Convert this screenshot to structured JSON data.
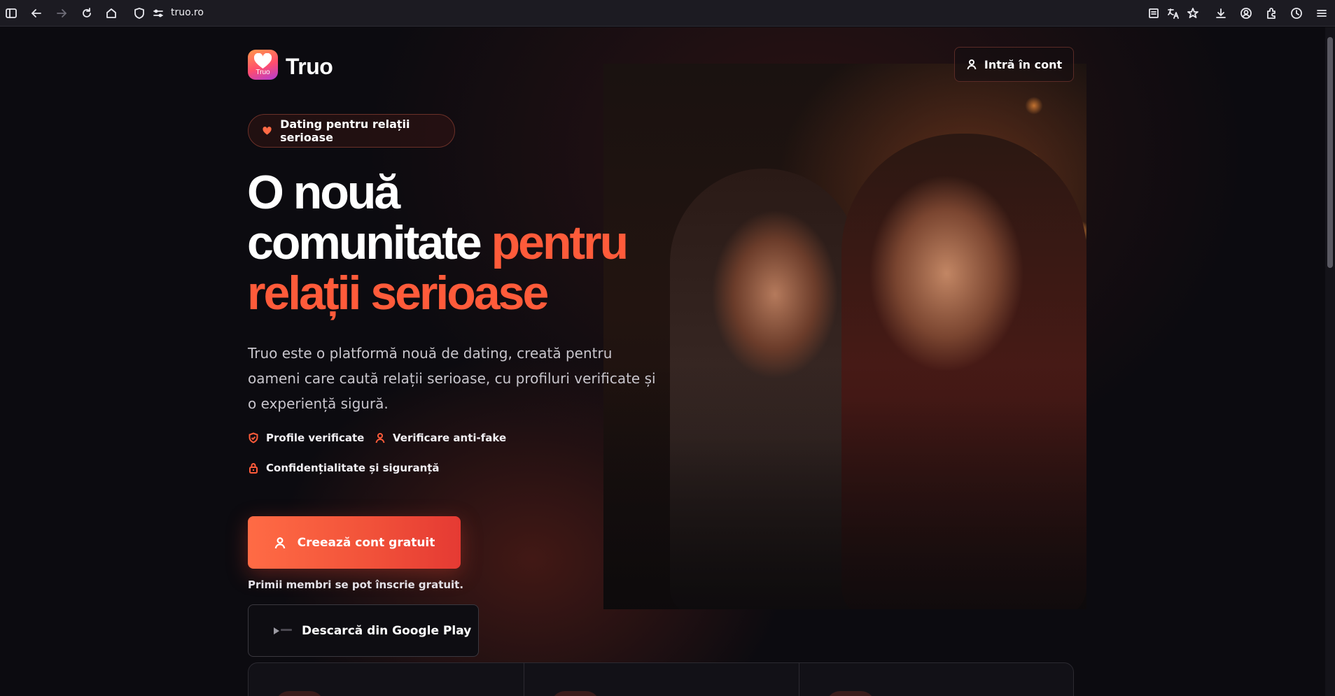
{
  "browser": {
    "url": "truo.ro",
    "icons": [
      "sidebar-icon",
      "back-icon",
      "forward-icon",
      "reload-icon",
      "home-icon",
      "shield-icon",
      "permissions-icon",
      "reader-icon",
      "translate-icon",
      "bookmark-star-icon",
      "download-icon",
      "account-icon",
      "extensions-icon",
      "history-icon",
      "menu-icon"
    ]
  },
  "header": {
    "logo_text": "Truo",
    "brand": "Truo",
    "login_label": "Intră în cont"
  },
  "hero": {
    "badge": "Dating pentru relații serioase",
    "title_line1": "O nouă",
    "title_line2_plain": "comunitate ",
    "title_line2_accent": "pentru",
    "title_line3_accent": "relații serioase",
    "description": "Truo este o platformă nouă de dating, creată pentru oameni care caută relații serioase, cu profiluri verificate și o experiență sigură.",
    "features": [
      {
        "label": "Profile verificate",
        "icon": "shield-check-icon"
      },
      {
        "label": "Verificare anti-fake",
        "icon": "user-icon"
      },
      {
        "label": "Confidențialitate și siguranță",
        "icon": "lock-icon"
      }
    ],
    "cta_label": "Creează cont gratuit",
    "note": "Primii membri se pot înscrie gratuit.",
    "gplay_label": "Descarcă din Google Play"
  },
  "colors": {
    "accent": "#ff5b3a",
    "background": "#0c0b10",
    "cta_start": "#ff6b45",
    "cta_end": "#e53a33"
  }
}
